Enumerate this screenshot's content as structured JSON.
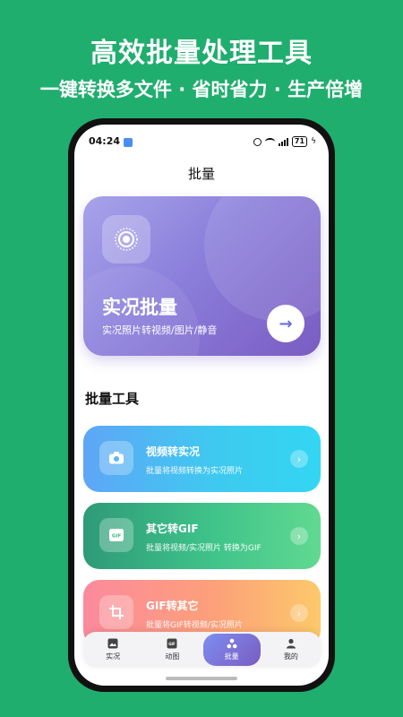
{
  "promo": {
    "title": "高效批量处理工具",
    "subtitle": "一键转换多文件 · 省时省力 · 生产倍增"
  },
  "status_bar": {
    "time": "04:24",
    "battery": "71"
  },
  "page": {
    "title": "批量"
  },
  "hero": {
    "title": "实况批量",
    "subtitle": "实况照片转视频/图片/静音",
    "arrow": "→",
    "icon": "live-photo-icon"
  },
  "section": {
    "title": "批量工具"
  },
  "tools": [
    {
      "title": "视频转实况",
      "desc": "批量将视频转换为实况照片",
      "icon": "camera-icon"
    },
    {
      "title": "其它转GIF",
      "desc": "批量将视频/实况照片 转换为GIF",
      "icon": "gif-icon"
    },
    {
      "title": "GIF转其它",
      "desc": "批量将GIF转视频/实况照片",
      "icon": "crop-icon"
    }
  ],
  "nav": [
    {
      "label": "实况",
      "icon": "image-icon"
    },
    {
      "label": "动图",
      "icon": "gif-icon"
    },
    {
      "label": "批量",
      "icon": "batch-icon",
      "active": true
    },
    {
      "label": "我的",
      "icon": "user-icon"
    }
  ],
  "colors": {
    "background": "#1fae6e",
    "hero_start": "#a8a3ea",
    "hero_end": "#7a5cc2",
    "card_blue": "#3fc9f0",
    "card_green": "#3fc48a",
    "card_orange": "#fca07a"
  }
}
